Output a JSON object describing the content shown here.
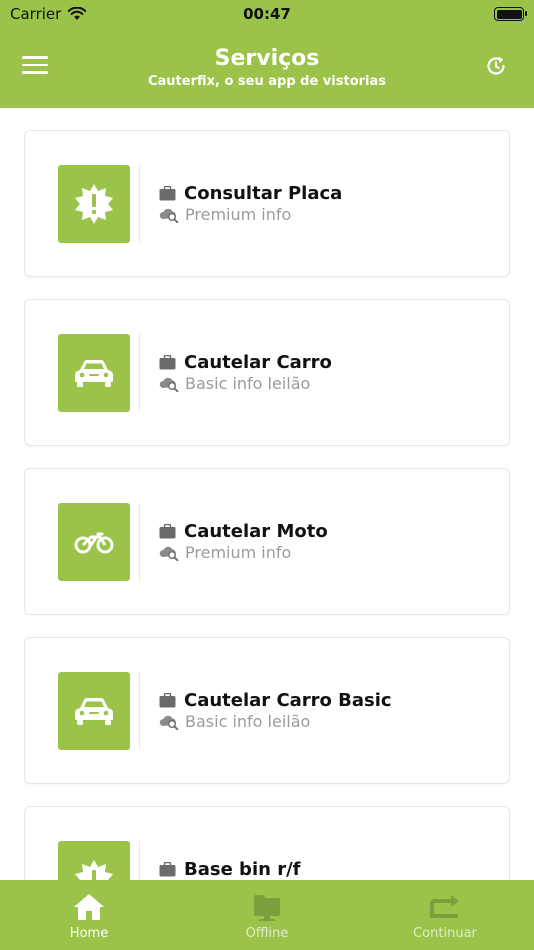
{
  "status_bar": {
    "carrier": "Carrier",
    "time": "00:47"
  },
  "header": {
    "title": "Serviços",
    "subtitle": "Cauterfix, o seu app de vistorias",
    "menu_icon": "hamburger-menu-icon",
    "refresh_icon": "refresh-icon"
  },
  "services": [
    {
      "name": "Consultar Placa",
      "description": "Premium info",
      "icon": "alert-badge-icon"
    },
    {
      "name": "Cautelar Carro",
      "description": "Basic info leilão",
      "icon": "car-icon"
    },
    {
      "name": "Cautelar Moto",
      "description": "Premium info",
      "icon": "motorcycle-icon"
    },
    {
      "name": "Cautelar Carro Basic",
      "description": "Basic info leilão",
      "icon": "car-icon"
    },
    {
      "name": "Base bin r/f",
      "description": "",
      "icon": "alert-badge-icon"
    }
  ],
  "tab_bar": {
    "tabs": [
      {
        "label": "Home",
        "icon": "home-icon",
        "active": true
      },
      {
        "label": "Offline",
        "icon": "offline-folder-icon",
        "active": false
      },
      {
        "label": "Continuar",
        "icon": "continue-arrow-icon",
        "active": false
      }
    ]
  },
  "colors": {
    "primary": "#9bc34a",
    "text": "#111111",
    "muted": "#9b9b9b",
    "icon_muted": "#6b6b6b"
  }
}
